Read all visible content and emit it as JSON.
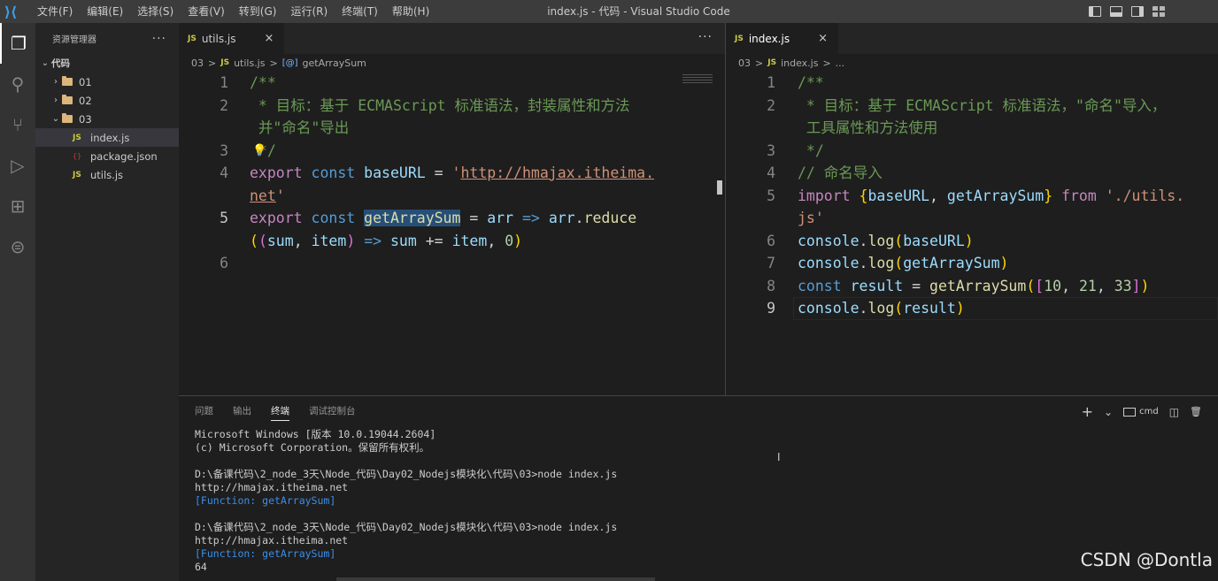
{
  "titlebar": {
    "menu": [
      "文件(F)",
      "编辑(E)",
      "选择(S)",
      "查看(V)",
      "转到(G)",
      "运行(R)",
      "终端(T)",
      "帮助(H)"
    ],
    "title": "index.js - 代码 - Visual Studio Code"
  },
  "activitybar": {
    "icons": [
      "explorer-icon",
      "search-icon",
      "source-control-icon",
      "run-debug-icon",
      "extensions-icon",
      "remote-icon"
    ]
  },
  "sidebar": {
    "header": "资源管理器",
    "more": "···",
    "root": "代码",
    "folders": [
      "01",
      "02",
      "03"
    ],
    "files": [
      "index.js",
      "package.json",
      "utils.js"
    ],
    "js_badge": "JS",
    "json_badge": "{}"
  },
  "left_editor": {
    "tab": {
      "badge": "JS",
      "label": "utils.js",
      "close": "×"
    },
    "more": "···",
    "breadcrumb": [
      "03",
      ">",
      "JS",
      "utils.js",
      ">",
      "[@]",
      "getArraySum"
    ],
    "line_numbers": [
      "1",
      "2",
      "3",
      "4",
      "5",
      "6"
    ],
    "lines": {
      "l1": "/**",
      "l2a": " * 目标：基于 ECMAScript 标准语法，封装属性和方法",
      "l2b": " 并\"命名\"导出",
      "l3": " */",
      "l4_kw": "export",
      "l4_const": "const",
      "l4_var": "baseURL",
      "l4_eq": "=",
      "l4_q": "'",
      "l4_str": "http://hmajax.itheima.",
      "l4b_str": "net",
      "l4b_q": "'",
      "l5_kw": "export",
      "l5_const": "const",
      "l5_fn": "getArraySum",
      "l5_eq": "=",
      "l5_arr": "arr",
      "l5_arrow": "=>",
      "l5_arr2": "arr",
      "l5_dot": ".",
      "l5_reduce": "reduce",
      "l5b_p1": "(",
      "l5b_p2": "(",
      "l5b_sum": "sum",
      "l5b_comma": ",",
      "l5b_item": "item",
      "l5b_p3": ")",
      "l5b_arrow": "=>",
      "l5b_sum2": "sum",
      "l5b_pluseq": "+=",
      "l5b_item2": "item",
      "l5b_comma2": ",",
      "l5b_zero": "0",
      "l5b_p4": ")"
    }
  },
  "right_editor": {
    "tab": {
      "badge": "JS",
      "label": "index.js",
      "close": "×"
    },
    "breadcrumb": [
      "03",
      ">",
      "JS",
      "index.js",
      ">",
      "..."
    ],
    "line_numbers": [
      "1",
      "2",
      "3",
      "4",
      "5",
      "6",
      "7",
      "8",
      "9"
    ],
    "lines": {
      "l1": "/**",
      "l2a": " * 目标：基于 ECMAScript 标准语法，\"命名\"导入，",
      "l2b": " 工具属性和方法使用",
      "l3": " */",
      "l4": "// 命名导入",
      "l5_import": "import",
      "l5_b1": "{",
      "l5_base": "baseURL",
      "l5_comma": ",",
      "l5_fn": "getArraySum",
      "l5_b2": "}",
      "l5_from": "from",
      "l5_str": "'./utils.",
      "l5b_str": "js'",
      "l6_console": "console",
      "l6_log": "log",
      "l6_arg": "baseURL",
      "l7_console": "console",
      "l7_log": "log",
      "l7_arg": "getArraySum",
      "l8_const": "const",
      "l8_var": "result",
      "l8_eq": "=",
      "l8_fn": "getArraySum",
      "l8_n1": "10",
      "l8_n2": "21",
      "l8_n3": "33",
      "l9_console": "console",
      "l9_log": "log",
      "l9_arg": "result"
    }
  },
  "panel": {
    "tabs": [
      "问题",
      "输出",
      "终端",
      "调试控制台"
    ],
    "active_tab": "终端",
    "actions": {
      "add": "+",
      "chevron": "⌄",
      "shell": "cmd",
      "split": "◫",
      "trash": "🗑",
      "more": "···"
    },
    "terminal": [
      "Microsoft Windows [版本 10.0.19044.2604]",
      "(c) Microsoft Corporation。保留所有权利。",
      "",
      "D:\\备课代码\\2_node_3天\\Node_代码\\Day02_Nodejs模块化\\代码\\03>node index.js",
      "http://hmajax.itheima.net",
      "[Function: getArraySum]",
      "",
      "D:\\备课代码\\2_node_3天\\Node_代码\\Day02_Nodejs模块化\\代码\\03>node index.js",
      "http://hmajax.itheima.net",
      "[Function: getArraySum]",
      "64"
    ]
  },
  "watermark": "CSDN @Dontla"
}
